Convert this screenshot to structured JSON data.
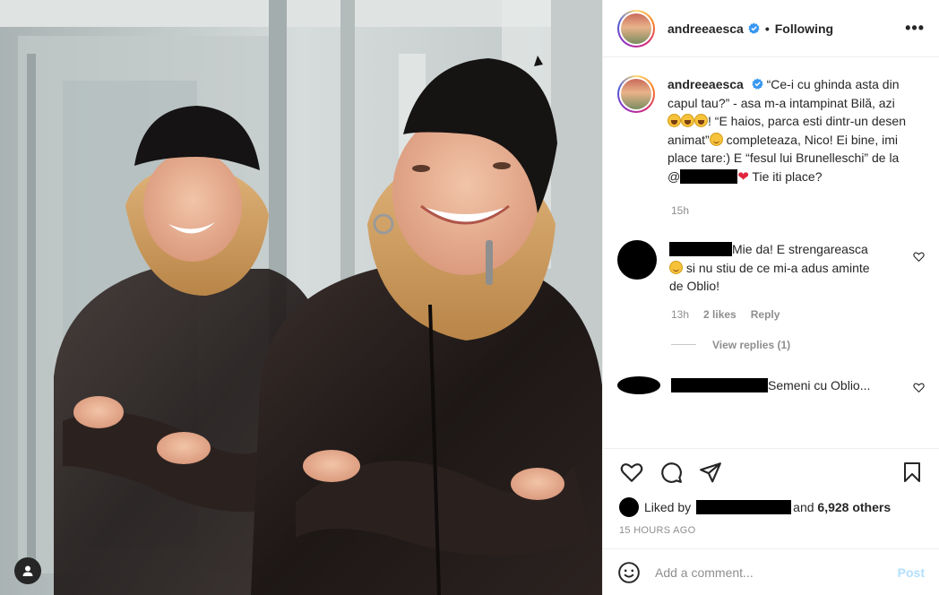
{
  "header": {
    "username": "andreeaesca",
    "separator": "•",
    "follow_status": "Following",
    "more": "•••"
  },
  "caption": {
    "username": "andreeaesca",
    "text_1": "“Ce-i cu ghinda asta din capul tau?” - asa m-a intampinat Bilă, azi",
    "text_2": "! “E haios, parca esti dintr-un desen animat”",
    "text_3": " completeaza, Nico! Ei bine, imi place tare:) E “fesul lui Brunelleschi” de la @",
    "text_4": " Tie iti place?",
    "time": "15h"
  },
  "comments": [
    {
      "text_1": "Mie da! E strengareasca",
      "text_2": " si nu stiu de ce mi-a adus aminte de Oblio!",
      "time": "13h",
      "likes": "2 likes",
      "reply": "Reply",
      "view_replies": "View replies (1)"
    },
    {
      "text": "Semeni cu Oblio..."
    }
  ],
  "likes": {
    "prefix": "Liked by",
    "suffix_and": "and",
    "others": "6,928 others"
  },
  "timestamp": "15 HOURS AGO",
  "add_comment": {
    "placeholder": "Add a comment...",
    "post_label": "Post"
  },
  "icons": {
    "verified": "verified-badge-icon",
    "heart": "heart-icon",
    "comment": "comment-icon",
    "share": "paper-plane-icon",
    "bookmark": "bookmark-icon",
    "emoji": "smiley-icon",
    "tag": "user-tag-icon"
  },
  "colors": {
    "verified": "#3897f0",
    "post_disabled": "#b2dffc",
    "meta": "#8e8e8e"
  }
}
